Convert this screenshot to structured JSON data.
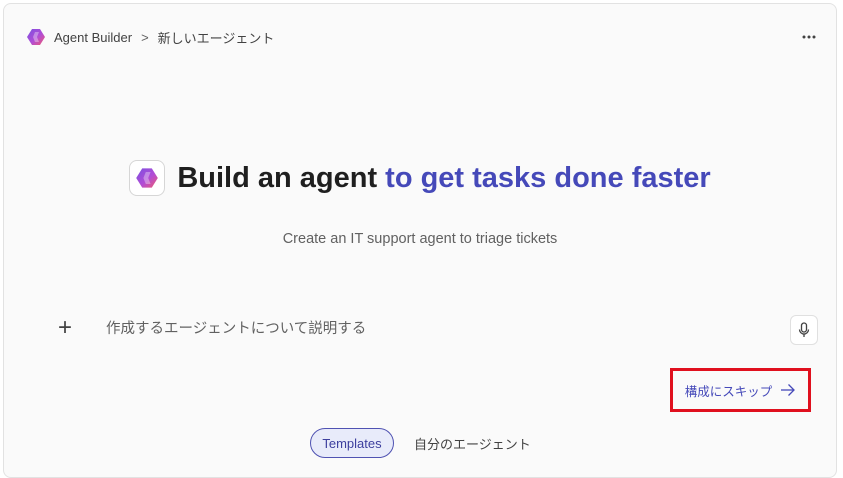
{
  "header": {
    "app_name": "Agent Builder",
    "separator": ">",
    "page_title": "新しいエージェント",
    "more_label": "···"
  },
  "hero": {
    "title_main": "Build an agent ",
    "title_accent": "to get tasks done faster",
    "accent_color": "#4549b9"
  },
  "suggestion": "Create an IT support agent to triage tickets",
  "prompt": {
    "add_label": "+",
    "placeholder": "作成するエージェントについて説明する",
    "value": ""
  },
  "skip": {
    "label": "構成にスキップ",
    "highlight_color": "#e0101e"
  },
  "tabs": [
    {
      "label": "Templates",
      "selected": true
    },
    {
      "label": "自分のエージェント",
      "selected": false
    }
  ],
  "icons": {
    "app_logo": "agent-builder-logo-icon",
    "more": "more-horizontal-icon",
    "mic": "microphone-icon",
    "arrow": "arrow-right-icon"
  }
}
